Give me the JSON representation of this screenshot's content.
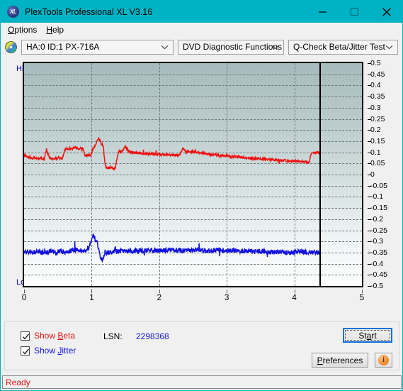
{
  "window": {
    "title": "PlexTools Professional XL V3.16",
    "icon": "app-xl-icon",
    "minimize": "minimize-icon",
    "maximize": "maximize-icon",
    "close": "close-icon",
    "accent": "#00b3c4"
  },
  "menu": {
    "items": [
      {
        "pre": "",
        "accel": "O",
        "post": "ptions"
      },
      {
        "pre": "",
        "accel": "H",
        "post": "elp"
      }
    ]
  },
  "toolbar": {
    "disc_icon": "optical-disc-icon",
    "drive_select": "HA:0 ID:1  PX-716A",
    "function_select": "DVD Diagnostic Functions",
    "test_select": "Q-Check Beta/Jitter Test"
  },
  "controls": {
    "show_beta": {
      "pre": "Show ",
      "accel": "B",
      "post": "eta",
      "checked": true,
      "color": "#e01010"
    },
    "show_jitter": {
      "pre": "Show ",
      "accel": "J",
      "post": "itter",
      "checked": true,
      "color": "#1010e0"
    },
    "lsn_label": "LSN:",
    "lsn_value": "2298368",
    "start_button": {
      "pre": "St",
      "accel": "a",
      "post": "rt"
    },
    "preferences_button": {
      "pre": "",
      "accel": "P",
      "post": "references"
    },
    "info_button": "info-icon",
    "info_glyph": "i"
  },
  "status": {
    "text": "Ready",
    "color": "#e01010"
  },
  "chart_data": {
    "type": "line",
    "title": "Q-Check Beta/Jitter Test",
    "xlabel": "",
    "ylabel": "",
    "xlim": [
      0,
      5
    ],
    "ylim": [
      -0.5,
      0.5
    ],
    "xticks": [
      0,
      1,
      2,
      3,
      4,
      5
    ],
    "xticklabels": [
      "0",
      "1",
      "2",
      "3",
      "4",
      "5"
    ],
    "yticks": [
      0.5,
      0.45,
      0.4,
      0.35,
      0.3,
      0.25,
      0.2,
      0.15,
      0.1,
      0.05,
      0,
      -0.05,
      -0.1,
      -0.15,
      -0.2,
      -0.25,
      -0.3,
      -0.35,
      -0.4,
      -0.45,
      -0.5
    ],
    "yticklabels": [
      "0.5",
      "0.45",
      "0.4",
      "0.35",
      "0.3",
      "0.25",
      "0.2",
      "0.15",
      "0.1",
      "0.05",
      "0",
      "-0.05",
      "-0.1",
      "-0.15",
      "-0.2",
      "-0.25",
      "-0.3",
      "-0.35",
      "-0.4",
      "-0.45",
      "-0.5"
    ],
    "axis_top_label": "High",
    "axis_bottom_label": "Low",
    "grid": true,
    "grid_style": "dashed",
    "data_end_marker_x": 4.37,
    "legend": [
      "Show Beta",
      "Show Jitter"
    ],
    "series": [
      {
        "name": "Beta",
        "color": "#ee1111",
        "x": [
          0.0,
          0.03,
          0.06,
          0.09,
          0.12,
          0.15,
          0.18,
          0.21,
          0.24,
          0.27,
          0.3,
          0.33,
          0.36,
          0.39,
          0.42,
          0.45,
          0.48,
          0.51,
          0.54,
          0.57,
          0.6,
          0.63,
          0.66,
          0.69,
          0.72,
          0.75,
          0.78,
          0.81,
          0.84,
          0.87,
          0.9,
          0.93,
          0.96,
          0.99,
          1.02,
          1.05,
          1.08,
          1.11,
          1.14,
          1.17,
          1.2,
          1.23,
          1.26,
          1.29,
          1.32,
          1.35,
          1.4,
          1.45,
          1.5,
          1.55,
          1.6,
          1.7,
          1.8,
          1.9,
          2.0,
          2.1,
          2.2,
          2.3,
          2.35,
          2.4,
          2.5,
          2.6,
          2.7,
          2.8,
          2.9,
          3.0,
          3.1,
          3.2,
          3.3,
          3.4,
          3.5,
          3.6,
          3.7,
          3.8,
          3.9,
          4.0,
          4.1,
          4.15,
          4.2,
          4.22,
          4.25,
          4.28,
          4.31,
          4.34,
          4.37
        ],
        "y": [
          0.09,
          0.082,
          0.075,
          0.08,
          0.072,
          0.078,
          0.074,
          0.07,
          0.076,
          0.072,
          0.068,
          0.118,
          0.086,
          0.07,
          0.072,
          0.074,
          0.07,
          0.076,
          0.074,
          0.072,
          0.112,
          0.118,
          0.114,
          0.12,
          0.116,
          0.122,
          0.118,
          0.114,
          0.12,
          0.116,
          0.088,
          0.086,
          0.09,
          0.086,
          0.118,
          0.13,
          0.15,
          0.162,
          0.14,
          0.132,
          0.04,
          0.032,
          0.028,
          0.034,
          0.026,
          0.03,
          0.108,
          0.104,
          0.126,
          0.104,
          0.098,
          0.096,
          0.094,
          0.092,
          0.09,
          0.09,
          0.088,
          0.086,
          0.118,
          0.104,
          0.102,
          0.098,
          0.094,
          0.09,
          0.086,
          0.084,
          0.08,
          0.078,
          0.074,
          0.072,
          0.07,
          0.068,
          0.066,
          0.064,
          0.062,
          0.06,
          0.058,
          0.058,
          0.056,
          0.06,
          0.094,
          0.098,
          0.096,
          0.1,
          0.098
        ]
      },
      {
        "name": "Jitter",
        "color": "#1111dd",
        "x": [
          0.0,
          0.05,
          0.1,
          0.15,
          0.2,
          0.25,
          0.3,
          0.35,
          0.4,
          0.45,
          0.5,
          0.55,
          0.6,
          0.65,
          0.7,
          0.75,
          0.8,
          0.85,
          0.9,
          0.95,
          1.0,
          1.02,
          1.05,
          1.08,
          1.1,
          1.13,
          1.16,
          1.2,
          1.25,
          1.3,
          1.4,
          1.5,
          1.6,
          1.7,
          1.8,
          1.9,
          2.0,
          2.1,
          2.2,
          2.3,
          2.4,
          2.5,
          2.6,
          2.7,
          2.8,
          2.9,
          3.0,
          3.1,
          3.2,
          3.3,
          3.4,
          3.5,
          3.6,
          3.7,
          3.8,
          3.9,
          4.0,
          4.1,
          4.2,
          4.3,
          4.37
        ],
        "y": [
          -0.345,
          -0.348,
          -0.346,
          -0.35,
          -0.344,
          -0.348,
          -0.346,
          -0.35,
          -0.344,
          -0.348,
          -0.346,
          -0.344,
          -0.348,
          -0.346,
          -0.34,
          -0.336,
          -0.338,
          -0.344,
          -0.346,
          -0.332,
          -0.3,
          -0.272,
          -0.288,
          -0.3,
          -0.33,
          -0.375,
          -0.382,
          -0.348,
          -0.35,
          -0.348,
          -0.344,
          -0.346,
          -0.342,
          -0.344,
          -0.34,
          -0.342,
          -0.34,
          -0.342,
          -0.338,
          -0.34,
          -0.342,
          -0.338,
          -0.34,
          -0.342,
          -0.34,
          -0.338,
          -0.342,
          -0.34,
          -0.344,
          -0.342,
          -0.346,
          -0.344,
          -0.346,
          -0.348,
          -0.346,
          -0.35,
          -0.348,
          -0.346,
          -0.35,
          -0.348,
          -0.35
        ]
      }
    ]
  }
}
